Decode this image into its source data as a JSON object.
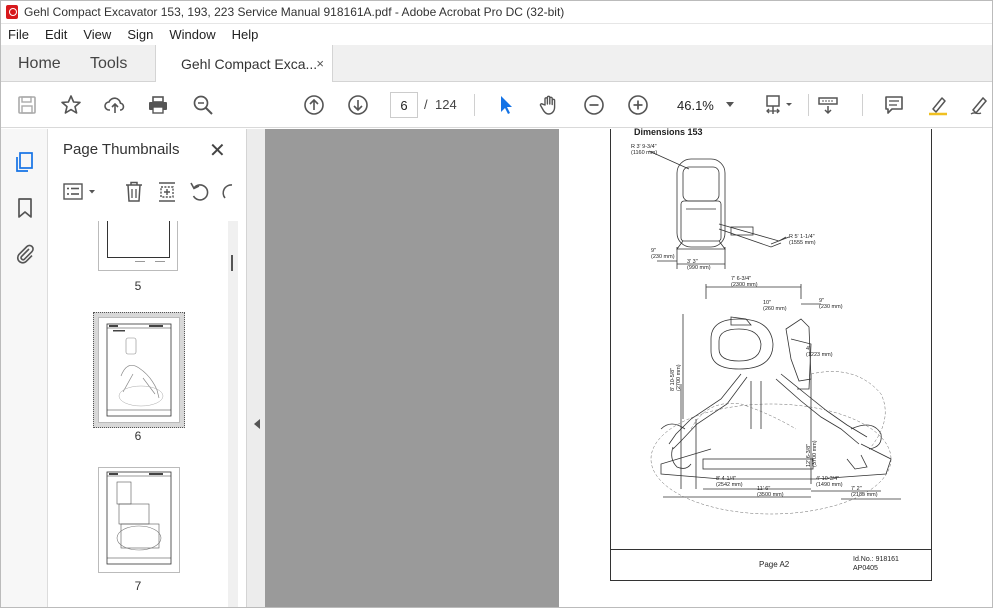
{
  "window": {
    "title": "Gehl Compact Excavator 153, 193, 223 Service Manual 918161A.pdf - Adobe Acrobat Pro DC (32-bit)"
  },
  "menu": [
    "File",
    "Edit",
    "View",
    "Sign",
    "Window",
    "Help"
  ],
  "tabs": {
    "home": "Home",
    "tools": "Tools",
    "document": "Gehl Compact Exca...",
    "close": "×"
  },
  "toolbar": {
    "current_page": "6",
    "separator": "/",
    "total_pages": "124",
    "zoom": "46.1%"
  },
  "thumbnails": {
    "title": "Page Thumbnails",
    "close": "✕",
    "pages": [
      {
        "label": "5"
      },
      {
        "label": "6",
        "selected": true
      },
      {
        "label": "7"
      }
    ]
  },
  "document_page": {
    "heading": "Dimensions 153",
    "page_label": "Page A2",
    "id_no": "Id.No.: 918161",
    "ap": "AP0405",
    "dimensions": [
      "R 3' 9-3/4\"\n(1160 mm)",
      "R 5' 1-1/4\"\n(1555 mm)",
      "9\"\n(230 mm)",
      "3' 3\"\n(990 mm)",
      "7' 6-3/4\"\n(2300 mm)",
      "10\"\n(260 mm)",
      "9\"\n(230 mm)",
      "4'\n(1223 mm)",
      "8' 10-5/8\"\n(2700 mm)",
      "12' 6-3/8\"\n(3700 mm)",
      "8' 4-1/4\"\n(2542 mm)",
      "4' 10-3/4\"\n(1490 mm)",
      "11' 6\"\n(3500 mm)",
      "7' 2\"\n(2185 mm)"
    ]
  },
  "colors": {
    "accent_blue": "#1473e6",
    "tab_bg": "#f0f0f0",
    "gray_canvas": "#9a9a9a",
    "acrobat_red": "#d7191c"
  }
}
